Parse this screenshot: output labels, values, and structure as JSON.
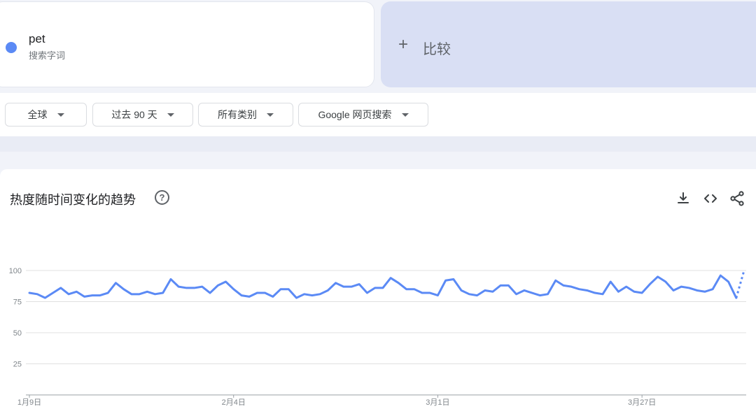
{
  "search_term": {
    "name": "pet",
    "type_label": "搜索字词",
    "color": "#5b8af5"
  },
  "compare": {
    "plus": "+",
    "label": "比较"
  },
  "filters": [
    {
      "label": "全球"
    },
    {
      "label": "过去 90 天"
    },
    {
      "label": "所有类别"
    },
    {
      "label": "Google 网页搜索"
    }
  ],
  "chart_section": {
    "title": "热度随时间变化的趋势",
    "help": "?",
    "icons": [
      "download-icon",
      "embed-code-icon",
      "share-icon"
    ]
  },
  "chart_data": {
    "type": "line",
    "title": "",
    "xlabel": "",
    "ylabel": "",
    "ylim": [
      0,
      100
    ],
    "yticks": [
      25,
      50,
      75,
      100
    ],
    "x_tick_labels": [
      {
        "label": "1月9日",
        "index": 0
      },
      {
        "label": "2月4日",
        "index": 26
      },
      {
        "label": "3月1日",
        "index": 52
      },
      {
        "label": "3月27日",
        "index": 78
      }
    ],
    "grid": true,
    "series": [
      {
        "color": "#5b8af5",
        "values": [
          82,
          81,
          78,
          82,
          86,
          81,
          83,
          79,
          80,
          80,
          82,
          90,
          85,
          81,
          81,
          83,
          81,
          82,
          93,
          87,
          86,
          86,
          87,
          82,
          88,
          91,
          85,
          80,
          79,
          82,
          82,
          79,
          85,
          85,
          78,
          81,
          80,
          81,
          84,
          90,
          87,
          87,
          89,
          82,
          86,
          86,
          94,
          90,
          85,
          85,
          82,
          82,
          80,
          92,
          93,
          84,
          81,
          80,
          84,
          83,
          88,
          88,
          81,
          84,
          82,
          80,
          81,
          92,
          88,
          87,
          85,
          84,
          82,
          81,
          91,
          83,
          87,
          83,
          82,
          89,
          95,
          91,
          84,
          87,
          86,
          84,
          83,
          85,
          96,
          91,
          78,
          100
        ],
        "partial_from_index": 90
      }
    ]
  }
}
